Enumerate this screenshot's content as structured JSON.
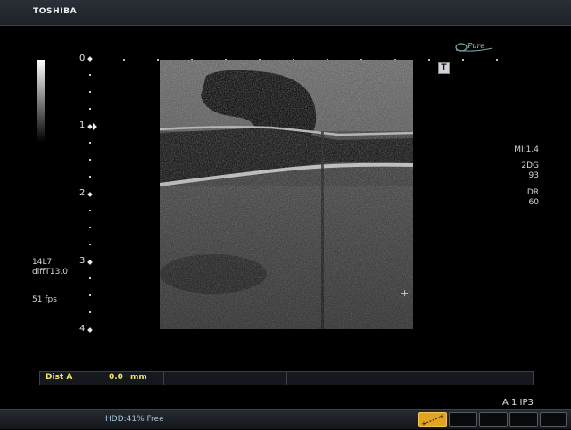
{
  "header": {
    "brand": "TOSHIBA"
  },
  "logo": {
    "text": "Pure"
  },
  "depth_scale": {
    "labels": [
      "0",
      "1",
      "2",
      "3",
      "4"
    ]
  },
  "image_marker": {
    "text": "T"
  },
  "left_params": {
    "probe": "14L7",
    "filter": "diffT13.0",
    "frame_rate": "51 fps"
  },
  "right_params": {
    "mi": "MI:1.4",
    "mode": "2DG",
    "gain": "93",
    "dr_label": "DR",
    "dr_value": "60"
  },
  "measurement": {
    "label": "Dist A",
    "value": "0.0",
    "unit": "mm"
  },
  "preset": {
    "text": "A 1   IP3"
  },
  "status": {
    "hdd": "HDD:41% Free"
  },
  "cursor": {
    "symbol": "+"
  }
}
